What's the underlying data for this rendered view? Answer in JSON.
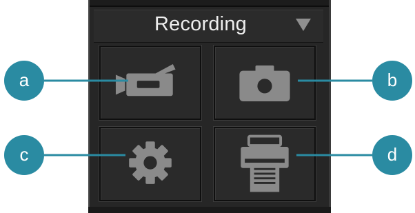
{
  "panel": {
    "title": "Recording",
    "dropdown_icon": "triangle-down-icon"
  },
  "buttons": [
    {
      "key": "a",
      "icon": "video-camera-icon"
    },
    {
      "key": "b",
      "icon": "photo-camera-icon"
    },
    {
      "key": "c",
      "icon": "gear-icon"
    },
    {
      "key": "d",
      "icon": "printer-icon"
    }
  ],
  "callouts": {
    "a": "a",
    "b": "b",
    "c": "c",
    "d": "d"
  },
  "colors": {
    "panel_bg": "#262626",
    "button_bg": "#2a2a2a",
    "icon_gray": "#8a8a8a",
    "callout_teal": "#2a8ba2",
    "title_text": "#eeeeee"
  }
}
